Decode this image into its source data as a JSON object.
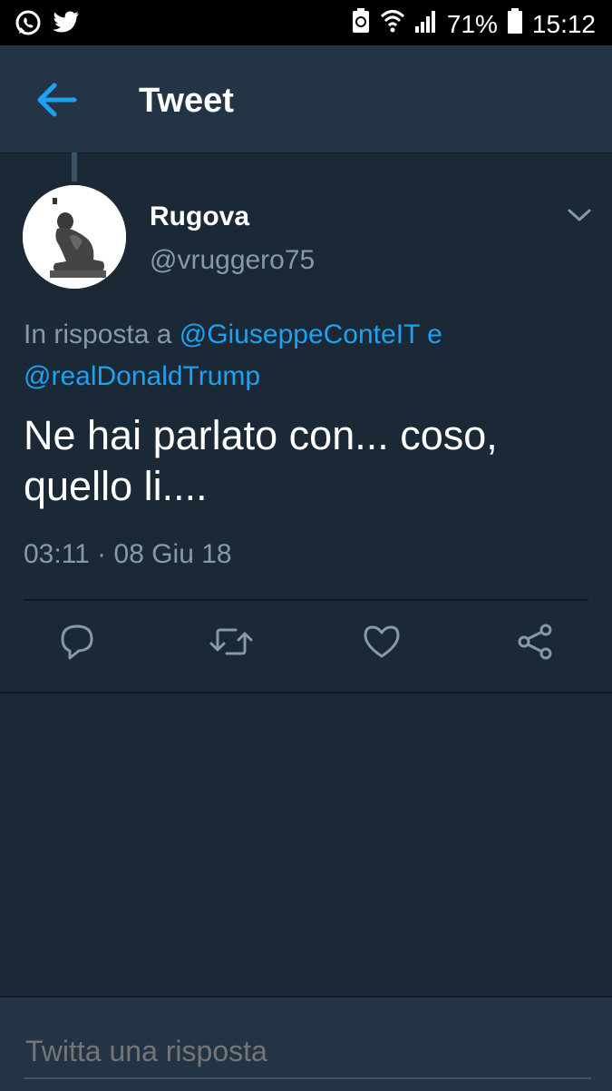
{
  "status_bar": {
    "left_icons": [
      "whatsapp-icon",
      "twitter-icon"
    ],
    "right_icons": [
      "battery-saver-icon",
      "wifi-icon",
      "signal-icon",
      "battery-icon"
    ],
    "battery": "71%",
    "time": "15:12"
  },
  "header": {
    "title": "Tweet",
    "back_icon": "arrow-left-icon"
  },
  "tweet": {
    "display_name": "Rugova",
    "handle": "@vruggero75",
    "reply_prefix": "In risposta a ",
    "mention_1": "@GiuseppeConteIT",
    "reply_join": " e",
    "mention_2": "@realDonaldTrump",
    "text": "Ne hai parlato con... coso, quello li....",
    "timestamp": "03:11 · 08 Giu 18"
  },
  "actions": [
    "reply-icon",
    "retweet-icon",
    "like-icon",
    "share-icon"
  ],
  "composer": {
    "placeholder": "Twitta una risposta"
  },
  "colors": {
    "background": "#1b2836",
    "header": "#243447",
    "accent": "#1da1f2",
    "muted": "#8899a6"
  }
}
